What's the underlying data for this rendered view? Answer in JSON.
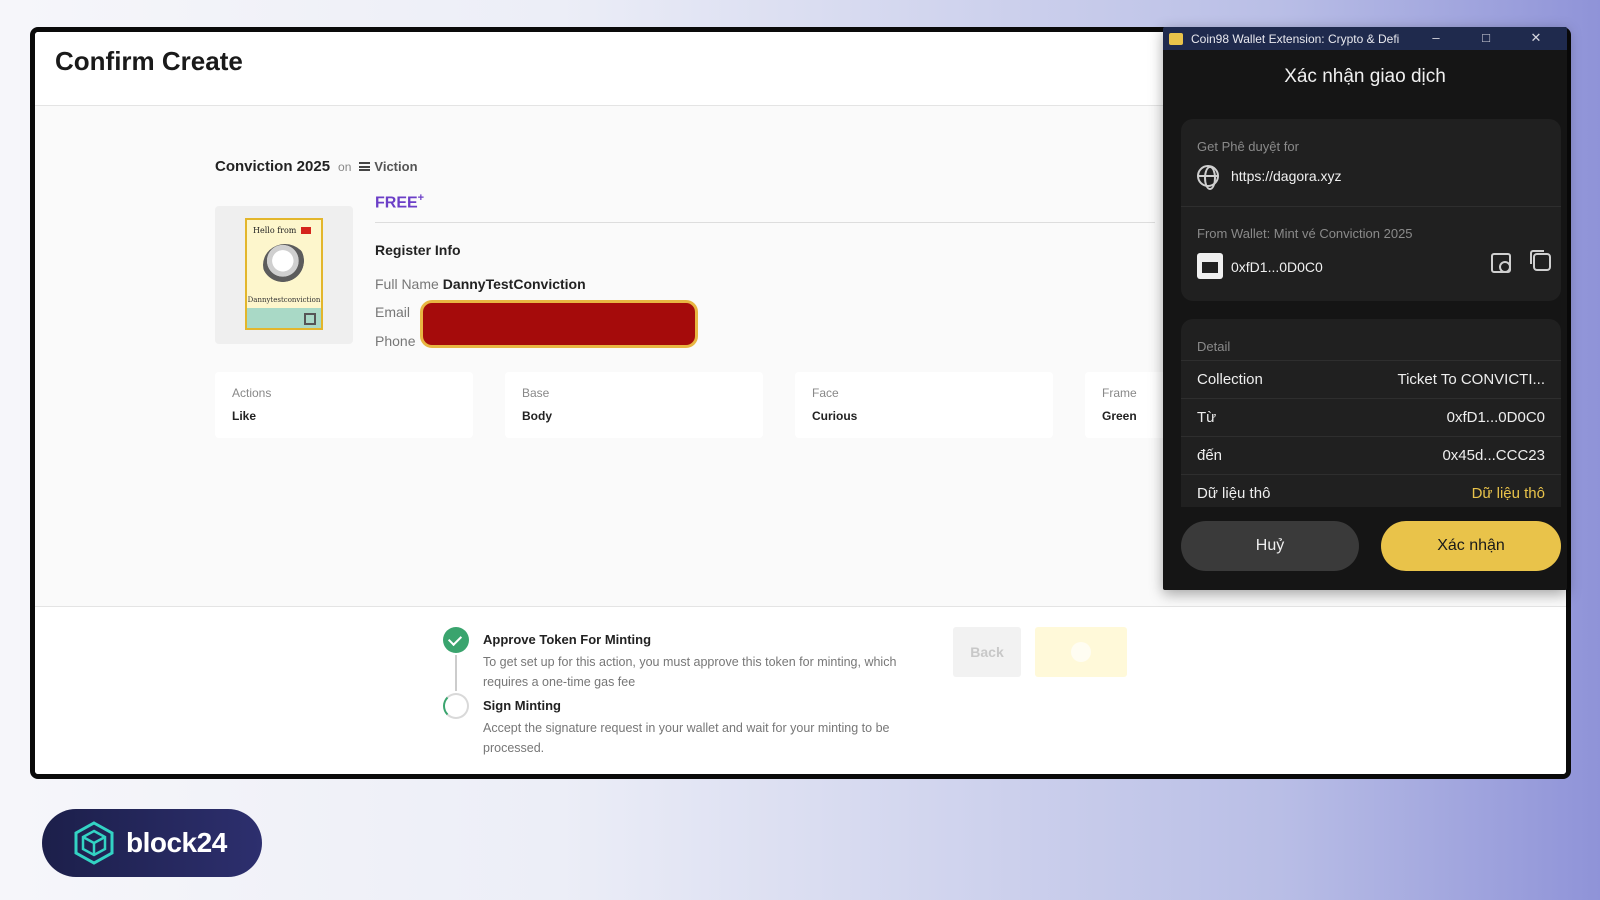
{
  "page": {
    "title": "Confirm Create",
    "collection_name": "Conviction 2025",
    "on_label": "on",
    "chain_name": "Viction"
  },
  "nft": {
    "hello_text": "Hello from",
    "holder_name": "Dannytestconviction"
  },
  "price": {
    "label": "FREE",
    "mark": "+"
  },
  "register": {
    "title": "Register Info",
    "full_name_label": "Full Name",
    "full_name_value": "DannyTestConviction",
    "email_label": "Email",
    "phone_label": "Phone"
  },
  "traits": [
    {
      "label": "Actions",
      "value": "Like"
    },
    {
      "label": "Base",
      "value": "Body"
    },
    {
      "label": "Face",
      "value": "Curious"
    },
    {
      "label": "Frame",
      "value": "Green"
    }
  ],
  "steps": [
    {
      "title": "Approve Token For Minting",
      "desc": "To get set up for this action, you must approve this token for minting, which requires a one-time gas fee",
      "status": "done"
    },
    {
      "title": "Sign Minting",
      "desc": "Accept the signature request in your wallet and wait for your minting to be processed.",
      "status": "pending"
    }
  ],
  "actions": {
    "back_label": "Back"
  },
  "wallet": {
    "window_title": "Coin98 Wallet Extension: Crypto & Defi",
    "controls": {
      "minimize": "–",
      "maximize": "□",
      "close": "✕"
    },
    "heading": "Xác nhận giao dịch",
    "approval_label": "Get Phê duyệt for",
    "site_url": "https://dagora.xyz",
    "from_wallet_label": "From Wallet: Mint vé Conviction 2025",
    "wallet_address": "0xfD1...0D0C0",
    "detail_label": "Detail",
    "details": [
      {
        "key": "Collection",
        "value": "Ticket To CONVICTI..."
      },
      {
        "key": "Từ",
        "value": "0xfD1...0D0C0"
      },
      {
        "key": "đến",
        "value": "0x45d...CCC23"
      },
      {
        "key": "Dữ liệu thô",
        "value": "Dữ liệu thô"
      }
    ],
    "cancel_label": "Huỷ",
    "confirm_label": "Xác nhận",
    "accent_color": "#e9c34a"
  },
  "brand": {
    "name": "block24"
  },
  "colors": {
    "price": "#6b3ec7",
    "success": "#3aa46e",
    "redaction": "#a50b0b"
  }
}
